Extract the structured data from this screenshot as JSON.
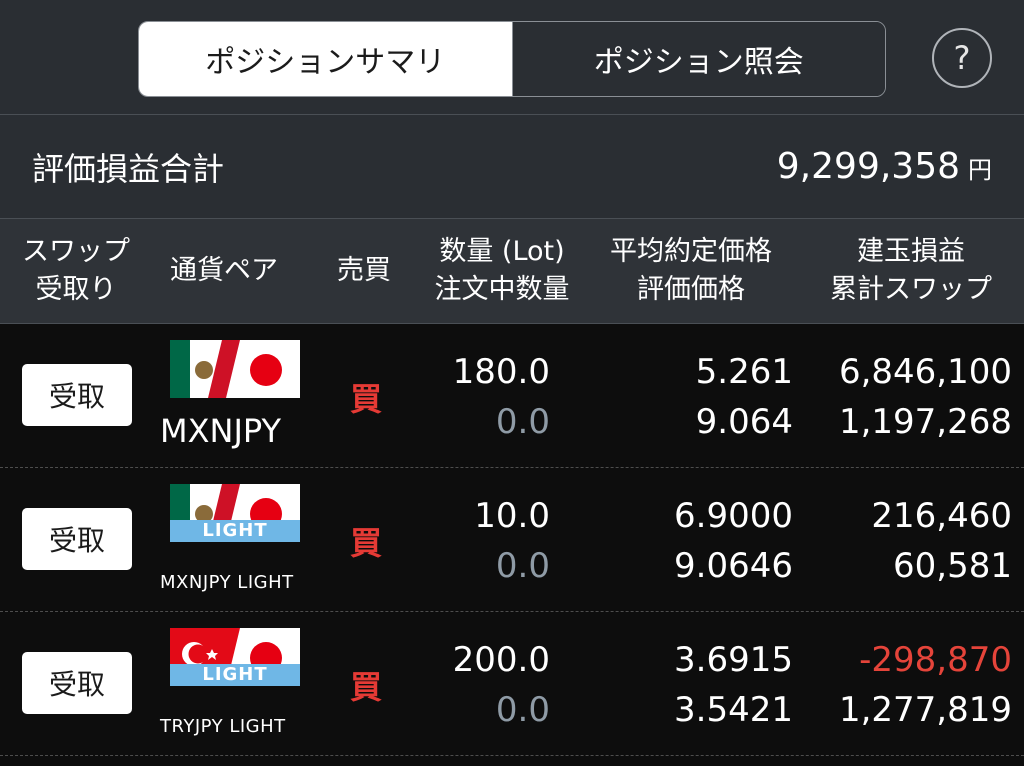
{
  "tabs": [
    {
      "label": "ポジションサマリ"
    },
    {
      "label": "ポジション照会"
    }
  ],
  "help_label": "?",
  "summary": {
    "label": "評価損益合計",
    "value": "9,299,358",
    "unit": "円"
  },
  "headers": {
    "swap": [
      "スワップ",
      "受取り"
    ],
    "pair": "通貨ペア",
    "side": "売買",
    "qty": [
      "数量 (Lot)",
      "注文中数量"
    ],
    "price": [
      "平均約定価格",
      "評価価格"
    ],
    "pl": [
      "建玉損益",
      "累計スワップ"
    ]
  },
  "rows": [
    {
      "button": "受取",
      "flag_icon": "mx-jp-flag-icon",
      "light": "",
      "pair": "MXNJPY",
      "side": "買",
      "qty": "180.0",
      "pending": "0.0",
      "avg_price": "5.261",
      "eval_price": "9.064",
      "pl": "6,846,100",
      "swap": "1,197,268"
    },
    {
      "button": "受取",
      "flag_icon": "mx-jp-flag-icon",
      "light": "LIGHT",
      "pair": "MXNJPY LIGHT",
      "side": "買",
      "qty": "10.0",
      "pending": "0.0",
      "avg_price": "6.9000",
      "eval_price": "9.0646",
      "pl": "216,460",
      "swap": "60,581"
    },
    {
      "button": "受取",
      "flag_icon": "tr-jp-flag-icon",
      "light": "LIGHT",
      "pair": "TRYJPY LIGHT",
      "side": "買",
      "qty": "200.0",
      "pending": "0.0",
      "avg_price": "3.6915",
      "eval_price": "3.5421",
      "pl": "-298,870",
      "swap": "1,277,819"
    }
  ],
  "colors": {
    "background": "#2a2e33",
    "list_background": "#0d0d0d",
    "buy_red": "#e53a35",
    "loss_red": "#e5443a",
    "light_band": "#6fb7e6",
    "pending_grey": "#8f9ba6"
  }
}
